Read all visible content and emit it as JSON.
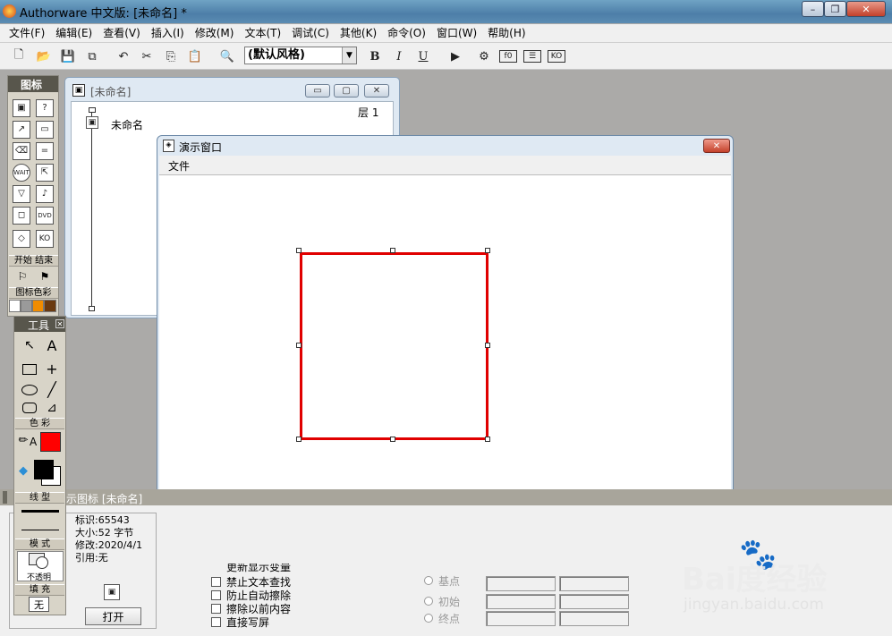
{
  "app": {
    "title": "Authorware 中文版: [未命名] *"
  },
  "window_controls": {
    "minimize": "–",
    "restore": "❐",
    "close": "✕"
  },
  "menu": [
    "文件(F)",
    "编辑(E)",
    "查看(V)",
    "插入(I)",
    "修改(M)",
    "文本(T)",
    "调试(C)",
    "其他(K)",
    "命令(O)",
    "窗口(W)",
    "帮助(H)"
  ],
  "toolbar": {
    "style_select": "(默认风格)",
    "bold": "B",
    "italic": "I",
    "underline": "U"
  },
  "icon_palette": {
    "title": "图标",
    "start_end": "开始 结束",
    "icon_color": "图标色彩"
  },
  "flow_window": {
    "title": "[未命名]",
    "layer": "层 1",
    "item": "未命名"
  },
  "presentation": {
    "title": "演示窗口",
    "menu_file": "文件"
  },
  "tools": {
    "title": "工具",
    "color_label": "色 彩",
    "line_label": "线 型",
    "mode_label": "模 式",
    "mode_value": "不透明",
    "fill_label": "填 充",
    "fill_value": "无",
    "pen_color": "#ff0000",
    "text_color": "A"
  },
  "properties": {
    "heading": "示图标 [未命名]",
    "id": "标识:65543",
    "size": "大小:52 字节",
    "modified": "修改:2020/4/1",
    "ref": "引用:无",
    "open_button": "打开",
    "options": [
      "禁止文本查找",
      "防止自动擦除",
      "擦除以前内容",
      "直接写屏"
    ],
    "hidden_partial": "更新显示变量",
    "radios": [
      "基点",
      "初始",
      "终点"
    ]
  },
  "watermark": {
    "brand": "Bai度经验",
    "url": "jingyan.baidu.com"
  }
}
